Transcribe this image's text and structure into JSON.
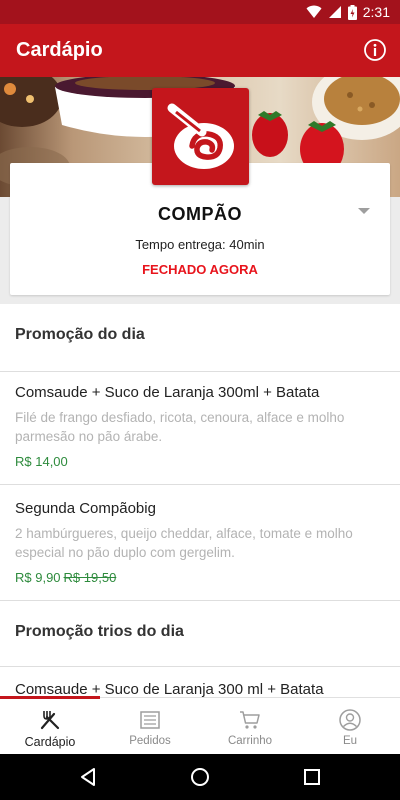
{
  "status_bar": {
    "time": "2:31"
  },
  "app_bar": {
    "title": "Cardápio",
    "info_icon": "info-icon"
  },
  "store": {
    "name": "COMPÃO",
    "delivery_time": "Tempo entrega: 40min",
    "status": "FECHADO AGORA"
  },
  "sections": [
    {
      "title": "Promoção do dia",
      "items": [
        {
          "name": "Comsaude + Suco de Laranja 300ml + Batata",
          "description": "Filé de frango desfiado, ricota, cenoura, alface e molho parmesão no pão árabe.",
          "price": "R$ 14,00",
          "old_price": ""
        },
        {
          "name": "Segunda Compãobig",
          "description": "2 hambúrgueres, queijo cheddar, alface, tomate e molho especial no pão duplo com gergelim.",
          "price": "R$ 9,90",
          "old_price": "R$ 19,50"
        }
      ]
    },
    {
      "title": "Promoção trios do dia",
      "items": [
        {
          "name": "Comsaude + Suco de Laranja 300 ml + Batata"
        }
      ]
    }
  ],
  "bottom_nav": [
    {
      "label": "Cardápio",
      "icon": "fork-knife-icon",
      "active": true
    },
    {
      "label": "Pedidos",
      "icon": "list-icon",
      "active": false
    },
    {
      "label": "Carrinho",
      "icon": "cart-icon",
      "active": false
    },
    {
      "label": "Eu",
      "icon": "user-icon",
      "active": false
    }
  ],
  "colors": {
    "primary": "#c4161c",
    "status_bar": "#a3121c",
    "closed": "#e8141c",
    "price": "#2e8b3d"
  }
}
